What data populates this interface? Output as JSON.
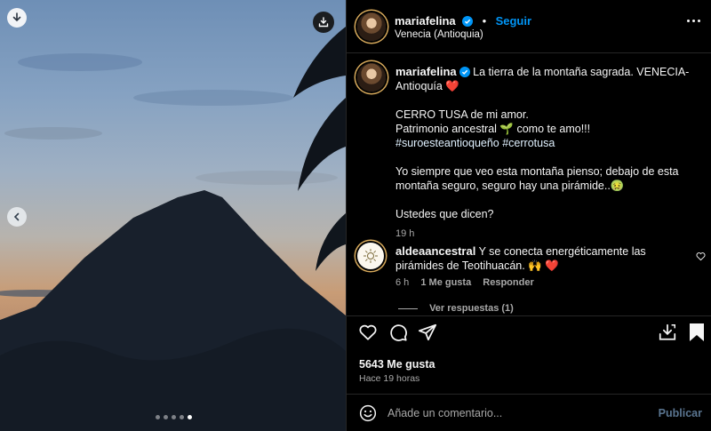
{
  "media": {
    "download_icon": "download-arrow-icon",
    "save_icon": "download-tray-icon",
    "prev_icon": "chevron-left-icon",
    "carousel": {
      "count": 5,
      "active_index": 4
    }
  },
  "header": {
    "username": "mariafelina",
    "separator": "•",
    "follow_label": "Seguir",
    "location": "Venecia (Antioquia)",
    "more_icon": "more-horizontal-icon"
  },
  "caption": {
    "username": "mariafelina",
    "line1": "La tierra de la montaña sagrada. VENECIA-Antioquía ❤️",
    "line2": "CERRO TUSA de mi amor.",
    "line3": "Patrimonio ancestral 🌱 como te amo!!!",
    "hashtags": "#suroesteantioqueño #cerrotusa",
    "line4": "Yo siempre que veo esta montaña pienso; debajo de esta montaña seguro, seguro hay una pirámide..🤢",
    "line5": "Ustedes que dicen?",
    "time": "19 h"
  },
  "comment": {
    "username": "aldeaancestral",
    "text": "Y se conecta energéticamente las pirámides de Teotihuacán. 🙌 ❤️",
    "time": "6 h",
    "likes": "1 Me gusta",
    "reply": "Responder",
    "view_replies": "Ver respuestas (1)"
  },
  "actions": {
    "likes": "5643 Me gusta",
    "timestamp": "Hace 19 horas"
  },
  "composer": {
    "placeholder": "Añade un comentario...",
    "publish_label": "Publicar"
  },
  "colors": {
    "accent": "#0095f6",
    "panel_bg": "#000000",
    "muted": "#a8a8a8"
  }
}
